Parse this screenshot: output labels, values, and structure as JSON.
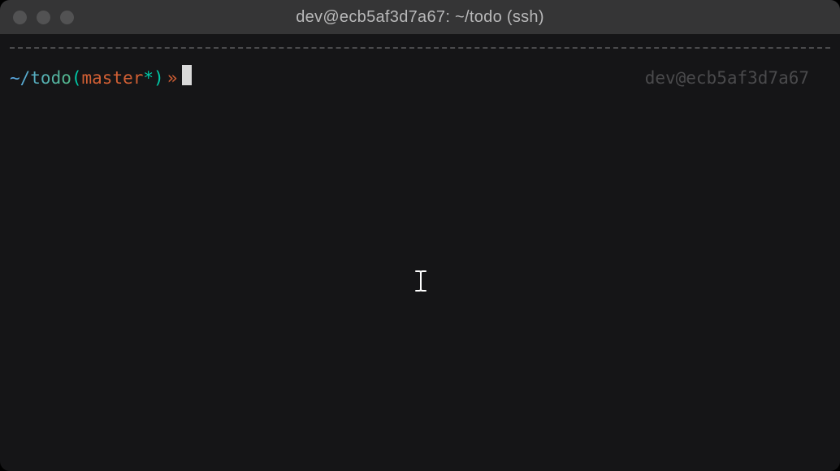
{
  "window": {
    "title": "dev@ecb5af3d7a67: ~/todo (ssh)"
  },
  "prompt": {
    "path": "~/todo",
    "paren_open": "(",
    "branch": "master",
    "dirty_marker": "*",
    "paren_close": ")",
    "symbol": " »"
  },
  "right_status": {
    "user_host": "dev@ecb5af3d7a67"
  }
}
